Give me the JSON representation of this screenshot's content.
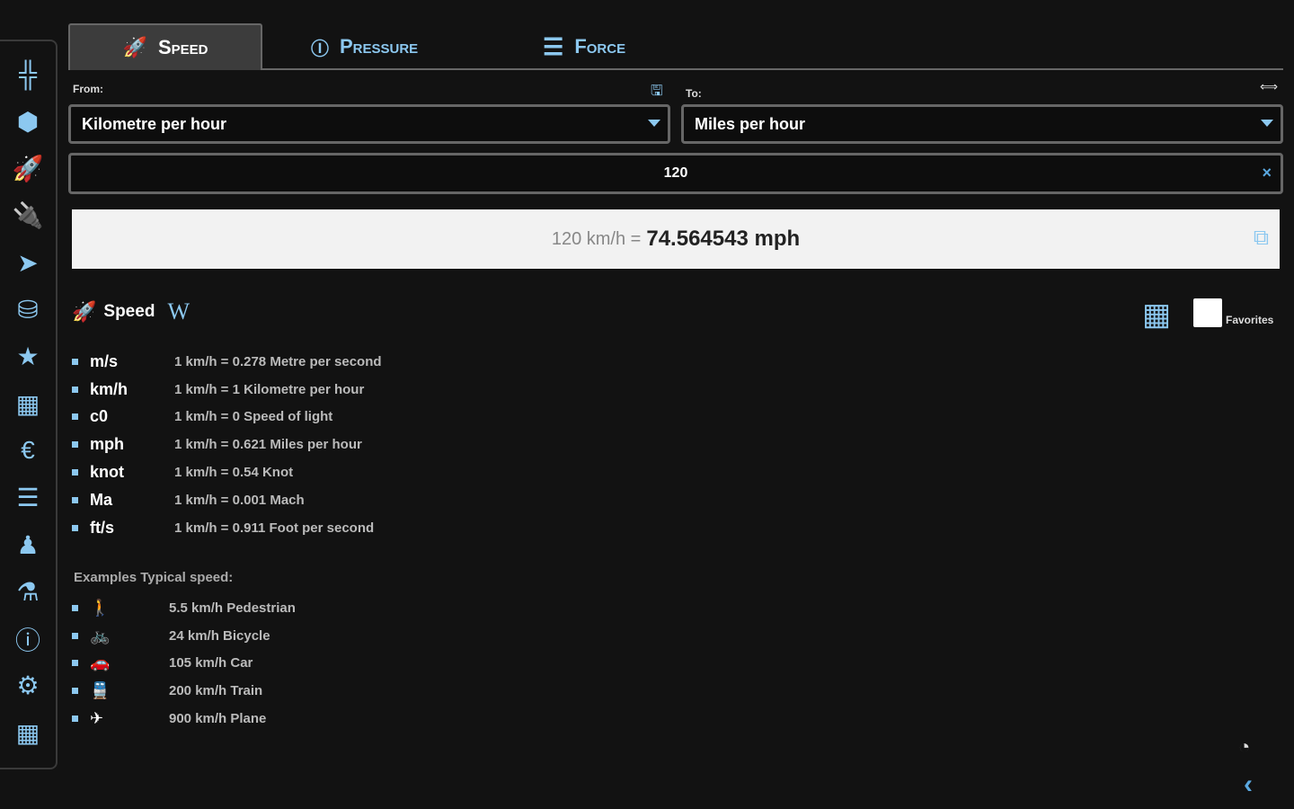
{
  "sidebar": {
    "items": [
      {
        "name": "length",
        "icon": "╬"
      },
      {
        "name": "volume",
        "icon": "⬢"
      },
      {
        "name": "speed",
        "icon": "🚀"
      },
      {
        "name": "power",
        "icon": "🔌"
      },
      {
        "name": "navigation",
        "icon": "➤"
      },
      {
        "name": "storage",
        "icon": "⛁"
      },
      {
        "name": "favorites",
        "icon": "★"
      },
      {
        "name": "calculator",
        "icon": "▦"
      },
      {
        "name": "currency",
        "icon": "€"
      },
      {
        "name": "list",
        "icon": "☰"
      },
      {
        "name": "person",
        "icon": "♟"
      },
      {
        "name": "chemistry",
        "icon": "⚗"
      },
      {
        "name": "info",
        "icon": "ⓘ"
      },
      {
        "name": "settings",
        "icon": "⚙"
      },
      {
        "name": "grid",
        "icon": "▦"
      }
    ]
  },
  "tabs": [
    {
      "label": "Speed",
      "icon": "🚀"
    },
    {
      "label": "Pressure",
      "icon": "ⓘ"
    },
    {
      "label": "Force",
      "icon": "☰"
    }
  ],
  "from": {
    "label": "From:",
    "value": "Kilometre per hour"
  },
  "to": {
    "label": "To:",
    "value": "Miles per hour"
  },
  "input": {
    "value": "120",
    "clear": "×"
  },
  "result": {
    "lhs": "120 km/h =",
    "rhs": "74.564543 mph"
  },
  "section": {
    "title": "Speed",
    "wiki": "W",
    "favorites": "Favorites"
  },
  "units": [
    {
      "u": "m/s",
      "d": "1 km/h = 0.278 Metre per second"
    },
    {
      "u": "km/h",
      "d": "1 km/h = 1 Kilometre per hour"
    },
    {
      "u": "c0",
      "d": "1 km/h = 0 Speed of light"
    },
    {
      "u": "mph",
      "d": "1 km/h = 0.621 Miles per hour"
    },
    {
      "u": "knot",
      "d": "1 km/h = 0.54 Knot"
    },
    {
      "u": "Ma",
      "d": "1 km/h = 0.001 Mach"
    },
    {
      "u": "ft/s",
      "d": "1 km/h = 0.911 Foot per second"
    }
  ],
  "examples": {
    "title": "Examples Typical speed:",
    "items": [
      {
        "icon": "🚶",
        "d": "5.5 km/h Pedestrian"
      },
      {
        "icon": "🚲",
        "d": "24 km/h Bicycle"
      },
      {
        "icon": "🚗",
        "d": "105 km/h Car"
      },
      {
        "icon": "🚆",
        "d": "200 km/h Train"
      },
      {
        "icon": "✈",
        "d": "900 km/h Plane"
      }
    ]
  }
}
